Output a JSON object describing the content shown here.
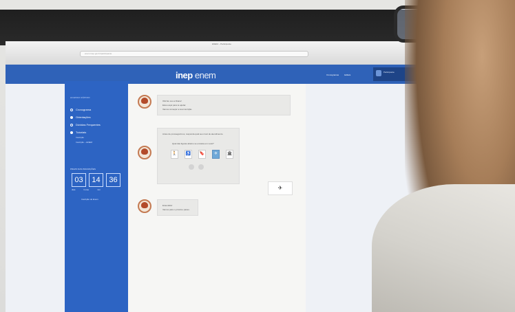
{
  "browser": {
    "title": "ENEM – Participante",
    "address": "enem.inep.gov.br/participante"
  },
  "header": {
    "brand_logo": "inep",
    "brand_name": "enem",
    "nav": [
      "Cronogramas",
      "Editais"
    ],
    "login_text": "Participante"
  },
  "sidebar": {
    "heading": "ACESSO RÁPIDO",
    "items": [
      {
        "label": "Cronograma",
        "icon": "clock-icon",
        "filled": false
      },
      {
        "label": "Orientações",
        "icon": "dot-icon",
        "filled": true
      },
      {
        "label": "Dúvidas Frequentes",
        "icon": "dot-icon",
        "filled": false
      },
      {
        "label": "Tutoriais",
        "icon": "dot-icon",
        "filled": true
      }
    ],
    "subitems": [
      "Inscrição",
      "Inscrição – ENEM"
    ],
    "countdown": {
      "title": "PRAZO DAS INSCRIÇÕES",
      "days": "03",
      "hours": "14",
      "minutes": "36",
      "labels": [
        "dias",
        "horas",
        "min"
      ],
      "link": "Inscrição do Enem"
    }
  },
  "chat": {
    "msg1_lines": [
      "Olá! Eu sou a Diana!",
      "Estou aqui para te ajudar.",
      "Vamos começar a sua inscrição."
    ],
    "msg2_lines": [
      "Antes de prosseguirmos, responda qual seu nível de atendimento.",
      "Qual das figuras abaixo se encaixa em você?"
    ],
    "options": [
      "🚶",
      "♿",
      "🔖",
      "✈",
      "🏛"
    ],
    "selected_option": 3,
    "user_reply": "✈",
    "msg3_lines": [
      "Entendido!",
      "Vamos para o próximo passo."
    ]
  }
}
